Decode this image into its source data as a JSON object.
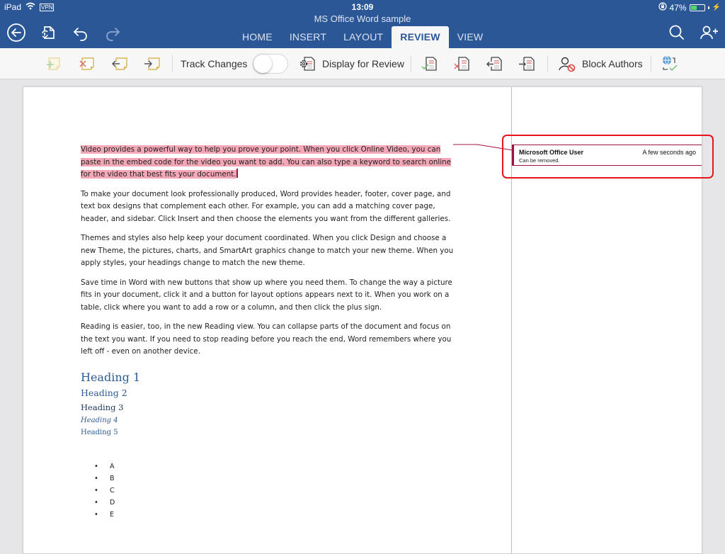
{
  "status_bar": {
    "device": "iPad",
    "vpn": "VPN",
    "time": "13:09",
    "battery_percent": "47%",
    "battery_level": 0.47
  },
  "app": {
    "document_title": "MS Office Word sample"
  },
  "nav_icons": {
    "back": "back-arrow-circle-icon",
    "sync": "document-sync-icon",
    "undo": "undo-icon",
    "redo": "redo-icon",
    "search": "search-icon",
    "share": "add-person-icon"
  },
  "tabs": [
    {
      "label": "HOME",
      "active": false
    },
    {
      "label": "INSERT",
      "active": false
    },
    {
      "label": "LAYOUT",
      "active": false
    },
    {
      "label": "REVIEW",
      "active": true
    },
    {
      "label": "VIEW",
      "active": false
    }
  ],
  "ribbon": {
    "new_comment": "new-comment-icon",
    "delete_comment": "delete-comment-icon",
    "previous_comment": "previous-comment-icon",
    "next_comment": "next-comment-icon",
    "track_changes_label": "Track Changes",
    "track_changes_on": false,
    "display_for_review_label": "Display for Review",
    "accept_change": "accept-change-icon",
    "reject_change": "reject-change-icon",
    "previous_change": "previous-change-icon",
    "next_change": "next-change-icon",
    "block_authors_label": "Block Authors",
    "language": "language-check-icon"
  },
  "document": {
    "highlighted_paragraph": "Video provides a powerful way to help you prove your point. When you click Online Video, you can paste in the embed code for the video you want to add. You can also type a keyword to search online for the video that best fits your document.",
    "paragraphs": [
      "To make your document look professionally produced, Word provides header, footer, cover page, and text box designs that complement each other. For example, you can add a matching cover page, header, and sidebar. Click Insert and then choose the elements you want from the different galleries.",
      "Themes and styles also help keep your document coordinated. When you click Design and choose a new Theme, the pictures, charts, and SmartArt graphics change to match your new theme. When you apply styles, your headings change to match the new theme.",
      "Save time in Word with new buttons that show up where you need them. To change the way a picture fits in your document, click it and a button for layout options appears next to it. When you work on a table, click where you want to add a row or a column, and then click the plus sign.",
      "Reading is easier, too, in the new Reading view. You can collapse parts of the document and focus on the text you want. If you need to stop reading before you reach the end, Word remembers where you left off - even on another device."
    ],
    "headings": [
      "Heading 1",
      "Heading 2",
      "Heading 3",
      "Heading 4",
      "Heading 5"
    ],
    "list_items": [
      "A",
      "B",
      "C",
      "D",
      "E"
    ],
    "bullet": "•"
  },
  "comment": {
    "author": "Microsoft Office User",
    "time": "A few seconds ago",
    "text": "Can be removed."
  },
  "colors": {
    "brand_blue": "#2b5797",
    "highlight": "#f4a8b7",
    "comment_accent": "#a0143c",
    "annotation_box": "#e8141b"
  }
}
